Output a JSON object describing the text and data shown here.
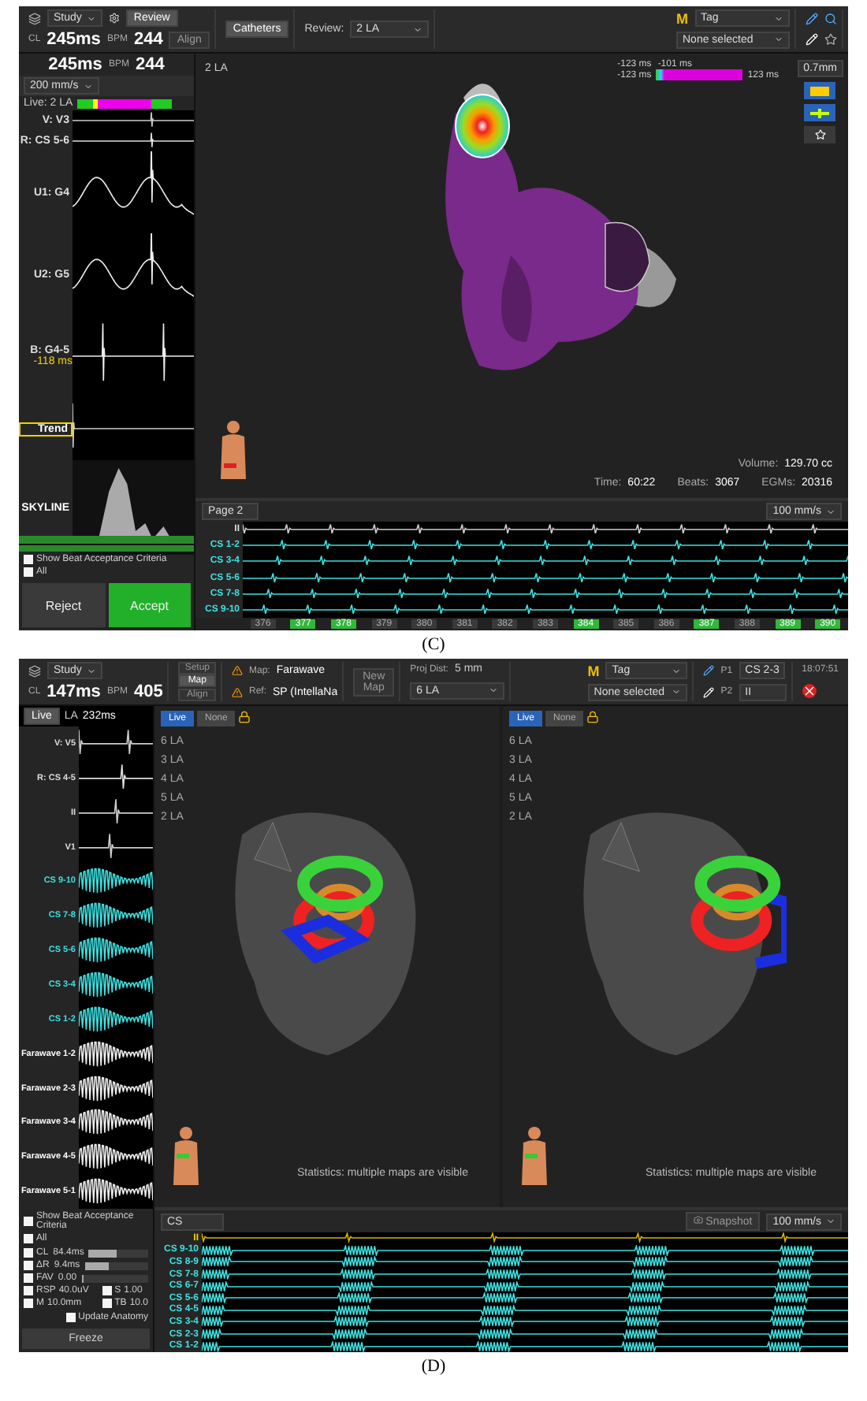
{
  "panel_c": {
    "caption": "(C)",
    "header": {
      "study": "Study",
      "review_tab": "Review",
      "align": "Align",
      "cl_label": "CL",
      "cl": "245ms",
      "bpm_label": "BPM",
      "bpm": "244",
      "catheters": "Catheters",
      "review_label": "Review:",
      "review_value": "2 LA",
      "tag_mark": "M",
      "tag": "Tag",
      "selection": "None selected"
    },
    "sidebar": {
      "cl": "245ms",
      "bpm_label": "BPM",
      "bpm": "244",
      "speed": "200 mm/s",
      "live": "Live: 2 LA",
      "traces": [
        {
          "label": "V: V3",
          "kind": "surface"
        },
        {
          "label": "R: CS 5-6",
          "kind": "reference"
        },
        {
          "label": "U1: G4",
          "kind": "unipolar"
        },
        {
          "label": "U2: G5",
          "kind": "unipolar"
        },
        {
          "label": "B: G4-5",
          "kind": "bipolar",
          "value": "-118 ms"
        }
      ],
      "trend": "Trend",
      "skyline": "SKYLINE",
      "show_criteria": {
        "label": "Show Beat Acceptance Criteria",
        "checked": true
      },
      "all": {
        "label": "All",
        "checked": true
      },
      "reject": "Reject",
      "accept": "Accept"
    },
    "view": {
      "map": "2 LA",
      "legend": {
        "top_left": "-123 ms",
        "top_right": "-101 ms",
        "min": "-123 ms",
        "max": "123 ms"
      },
      "resolution": "0.7mm",
      "volume": {
        "label": "Volume:",
        "value": "129.70 cc"
      },
      "stats": [
        {
          "label": "Time:",
          "value": "60:22"
        },
        {
          "label": "Beats:",
          "value": "3067"
        },
        {
          "label": "EGMs:",
          "value": "20316"
        }
      ]
    },
    "strip": {
      "page": "Page 2",
      "speed": "100 mm/s",
      "channels": [
        "II",
        "CS 1-2",
        "CS 3-4",
        "CS 5-6",
        "CS 7-8",
        "CS 9-10"
      ],
      "beats": [
        {
          "number": "376",
          "accepted": false
        },
        {
          "number": "377",
          "accepted": true
        },
        {
          "number": "378",
          "accepted": true
        },
        {
          "number": "379",
          "accepted": false
        },
        {
          "number": "380",
          "accepted": false
        },
        {
          "number": "381",
          "accepted": false
        },
        {
          "number": "382",
          "accepted": false
        },
        {
          "number": "383",
          "accepted": false
        },
        {
          "number": "384",
          "accepted": true
        },
        {
          "number": "385",
          "accepted": false
        },
        {
          "number": "386",
          "accepted": false
        },
        {
          "number": "387",
          "accepted": true
        },
        {
          "number": "388",
          "accepted": false
        },
        {
          "number": "389",
          "accepted": true
        },
        {
          "number": "390",
          "accepted": true
        }
      ]
    }
  },
  "panel_d": {
    "caption": "(D)",
    "header": {
      "study": "Study",
      "cl_label": "CL",
      "cl": "147ms",
      "bpm_label": "BPM",
      "bpm": "405",
      "modes": [
        {
          "label": "Setup",
          "selected": false
        },
        {
          "label": "Map",
          "selected": true
        },
        {
          "label": "Align",
          "selected": false
        }
      ],
      "map_label": "Map:",
      "map": "Farawave",
      "ref_label": "Ref:",
      "ref": "SP (IntellaNa",
      "new_map": "New Map",
      "proj_label": "Proj Dist:",
      "proj": "5 mm",
      "map_select": "6 LA",
      "tag_mark": "M",
      "tag": "Tag",
      "selection": "None selected",
      "p1_label": "P1",
      "p1": "CS 2-3",
      "p2_label": "P2",
      "p2": "II",
      "time": "18:07:51"
    },
    "sidebar": {
      "live": "Live",
      "map": "LA",
      "cl": "232ms",
      "traces": [
        {
          "label": "V: V5",
          "kind": "surface"
        },
        {
          "label": "R: CS 4-5",
          "kind": "reference"
        },
        {
          "label": "II",
          "kind": "surface"
        },
        {
          "label": "V1",
          "kind": "surface"
        },
        {
          "label": "CS 9-10",
          "kind": "cs"
        },
        {
          "label": "CS 7-8",
          "kind": "cs"
        },
        {
          "label": "CS 5-6",
          "kind": "cs"
        },
        {
          "label": "CS 3-4",
          "kind": "cs"
        },
        {
          "label": "CS 1-2",
          "kind": "cs"
        },
        {
          "label": "Farawave 1-2",
          "kind": "ablation"
        },
        {
          "label": "Farawave 2-3",
          "kind": "ablation"
        },
        {
          "label": "Farawave 3-4",
          "kind": "ablation"
        },
        {
          "label": "Farawave 4-5",
          "kind": "ablation"
        },
        {
          "label": "Farawave 5-1",
          "kind": "ablation"
        }
      ],
      "show_criteria": {
        "label": "Show Beat Acceptance Criteria",
        "checked": true
      },
      "all": {
        "label": "All",
        "checked": true
      },
      "criteria": [
        {
          "label": "CL",
          "value": "84.4ms",
          "level": 0.45,
          "checked": true
        },
        {
          "label": "ΔR",
          "value": "9.4ms",
          "level": 0.35,
          "checked": true
        },
        {
          "label": "FAV",
          "value": "0.00",
          "level": 0,
          "checked": true
        }
      ],
      "params": [
        {
          "label": "RSP",
          "value": "40.0uV",
          "checked": true
        },
        {
          "label": "S",
          "value": "1.00",
          "checked": true
        },
        {
          "label": "M",
          "value": "10.0mm",
          "checked": true
        },
        {
          "label": "TB",
          "value": "10.0",
          "checked": true
        }
      ],
      "update_anatomy": {
        "label": "Update Anatomy",
        "checked": true
      },
      "freeze": "Freeze"
    },
    "views": [
      {
        "tabs": [
          {
            "label": "Live",
            "selected": true
          },
          {
            "label": "None",
            "selected": false
          }
        ],
        "maps": [
          "6 LA",
          "3 LA",
          "4 LA",
          "5 LA",
          "2 LA"
        ],
        "statistics": "Statistics: multiple maps are visible"
      },
      {
        "tabs": [
          {
            "label": "Live",
            "selected": true
          },
          {
            "label": "None",
            "selected": false
          }
        ],
        "maps": [
          "6 LA",
          "3 LA",
          "4 LA",
          "5 LA",
          "2 LA"
        ],
        "statistics": "Statistics: multiple maps are visible"
      }
    ],
    "strip": {
      "catheter": "CS",
      "snapshot": "Snapshot",
      "speed": "100 mm/s",
      "channels": [
        "II",
        "CS 9-10",
        "CS 8-9",
        "CS 7-8",
        "CS 6-7",
        "CS 5-6",
        "CS 4-5",
        "CS 3-4",
        "CS 2-3",
        "CS 1-2"
      ]
    }
  }
}
